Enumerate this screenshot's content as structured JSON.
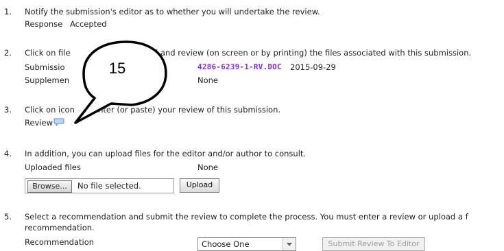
{
  "steps": [
    {
      "num": "1.",
      "text": "Notify the submission's editor as to whether you will undertake the review.",
      "response_label": "Response",
      "response_value": "Accepted"
    },
    {
      "num": "2.",
      "text_before": "Click on file",
      "text_after": "ad and review (on screen or by printing) the files associated with this submission.",
      "submission_label": "Submissio",
      "submission_file": "4286-6239-1-RV.DOC",
      "submission_date": "2015-09-29",
      "supplementary_label": "Supplemen",
      "supplementary_value": "None"
    },
    {
      "num": "3.",
      "text_before": "Click on icon",
      "text_after": "enter (or paste) your review of this submission.",
      "review_label": "Review",
      "review_icon": "comment-bubble-icon"
    },
    {
      "num": "4.",
      "text": "In addition, you can upload files for the editor and/or author to consult.",
      "uploaded_label": "Uploaded files",
      "uploaded_value": "None",
      "browse_label": "Browse...",
      "no_file_text": "No file selected.",
      "upload_label": "Upload"
    },
    {
      "num": "5.",
      "text_line1": "Select a recommendation and submit the review to complete the process. You must enter a review or upload a f",
      "text_line2": "recommendation.",
      "recommendation_label": "Recommendation",
      "select_value": "Choose One",
      "submit_label": "Submit Review To Editor"
    }
  ],
  "callout": {
    "number": "15"
  },
  "colors": {
    "file_link": "#8a2be2",
    "callout_stroke": "#000000"
  }
}
